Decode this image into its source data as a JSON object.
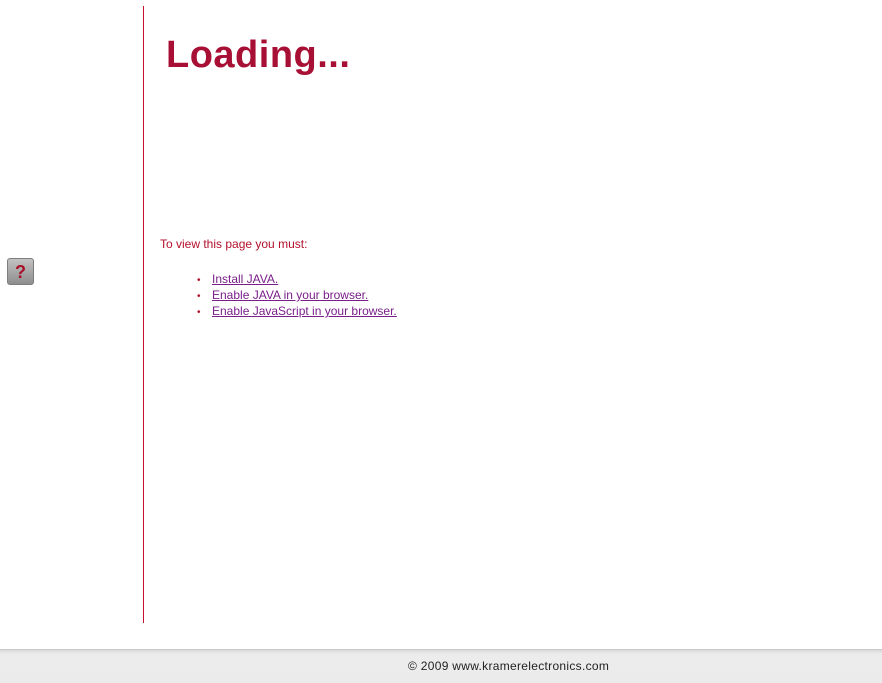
{
  "header": {
    "title": "Loading..."
  },
  "help_button": {
    "label": "?"
  },
  "main": {
    "instructions": "To view this page you must:",
    "requirements": [
      {
        "bullet": "•",
        "label": "Install JAVA."
      },
      {
        "bullet": "•",
        "label": "Enable JAVA in your browser."
      },
      {
        "bullet": "•",
        "label": "Enable JavaScript in your browser."
      }
    ]
  },
  "footer": {
    "copyright": "© 2009 www.kramerelectronics.com"
  },
  "colors": {
    "accent": "#a80f35",
    "link": "#7a1f8a",
    "footer_bg": "#ebebeb"
  }
}
